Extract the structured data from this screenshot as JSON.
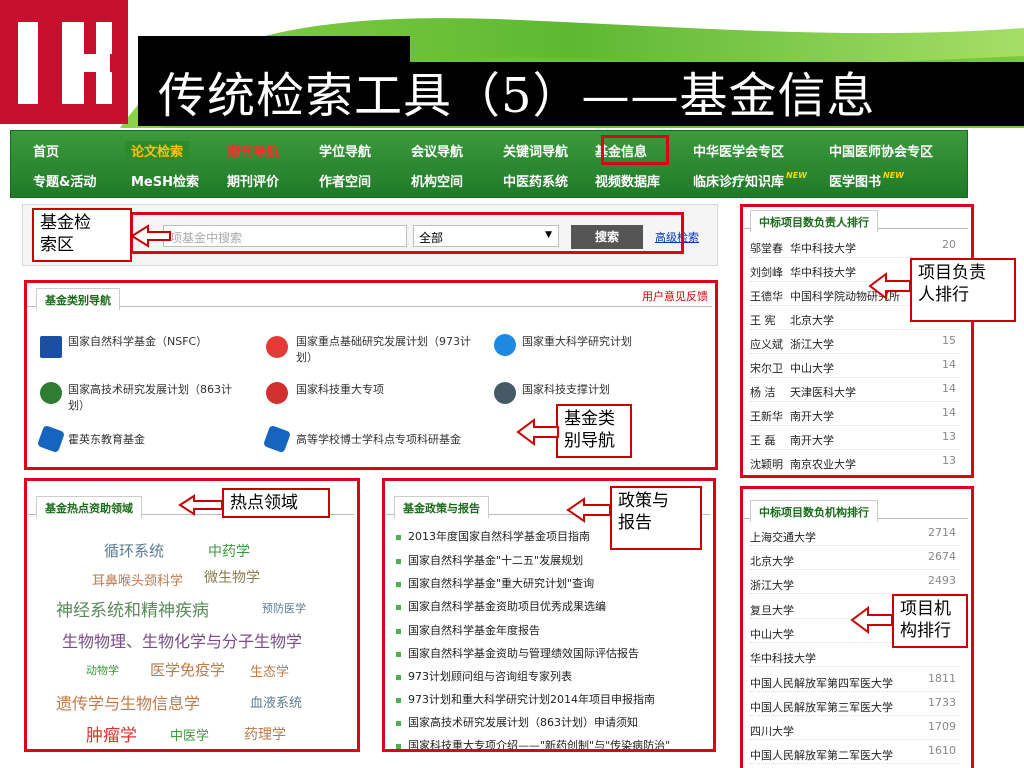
{
  "slide": {
    "title": "传统检索工具（5）——基金信息"
  },
  "colors": {
    "brand_green": "#2d8a2d",
    "annotation_red": "#e0001b",
    "logo_red": "#c8102e"
  },
  "nav": {
    "row1": [
      "首页",
      "论文检索",
      "期刊导航",
      "学位导航",
      "会议导航",
      "关键词导航",
      "基金信息",
      "中华医学会专区",
      "中国医师协会专区"
    ],
    "row2": [
      "专题&活动",
      "MeSH检索",
      "期刊评价",
      "作者空间",
      "机构空间",
      "中医药系统",
      "视频数据库",
      "临床诊疗知识库",
      "医学图书"
    ],
    "new_badge": "NEW"
  },
  "search": {
    "callout": "基金检索区",
    "placeholder": "项基金中搜索",
    "scope": "全部",
    "button": "搜索",
    "advanced": "高级检索"
  },
  "category_nav": {
    "tab": "基金类别导航",
    "feedback": "用户意见反馈",
    "callout": "基金类别导航",
    "items": [
      "国家自然科学基金（NSFC）",
      "国家重点基础研究发展计划（973计划）",
      "国家重大科学研究计划",
      "国家高技术研究发展计划（863计划）",
      "国家科技重大专项",
      "国家科技支撑计划",
      "霍英东教育基金",
      "高等学校博士学科点专项科研基金"
    ]
  },
  "leader_rank": {
    "tab": "中标项目数负责人排行",
    "callout": "项目负责人排行",
    "rows": [
      {
        "name": "邬堂春",
        "org": "华中科技大学",
        "count": "20"
      },
      {
        "name": "刘剑峰",
        "org": "华中科技大学",
        "count": "16"
      },
      {
        "name": "王德华",
        "org": "中国科学院动物研究所",
        "count": ""
      },
      {
        "name": "王  宪",
        "org": "北京大学",
        "count": ""
      },
      {
        "name": "应义斌",
        "org": "浙江大学",
        "count": "15"
      },
      {
        "name": "宋尔卫",
        "org": "中山大学",
        "count": "14"
      },
      {
        "name": "杨  洁",
        "org": "天津医科大学",
        "count": "14"
      },
      {
        "name": "王新华",
        "org": "南开大学",
        "count": "14"
      },
      {
        "name": "王  磊",
        "org": "南开大学",
        "count": "13"
      },
      {
        "name": "沈颖明",
        "org": "南京农业大学",
        "count": "13"
      }
    ]
  },
  "hot_topics": {
    "tab": "基金热点资助领域",
    "callout": "热点领域",
    "keywords": [
      "循环系统",
      "中药学",
      "耳鼻喉头颈科学",
      "微生物学",
      "神经系统和精神疾病",
      "预防医学",
      "生物物理、生物化学与分子生物学",
      "动物学",
      "医学免疫学",
      "生态学",
      "遗传学与生物信息学",
      "血液系统",
      "肿瘤学",
      "中医学",
      "药理学"
    ]
  },
  "policy": {
    "tab": "基金政策与报告",
    "callout": "政策与报告",
    "items": [
      "2013年度国家自然科学基金项目指南",
      "国家自然科学基金\"十二五\"发展规划",
      "国家自然科学基金\"重大研究计划\"查询",
      "国家自然科学基金资助项目优秀成果选编",
      "国家自然科学基金年度报告",
      "国家自然科学基金资助与管理绩效国际评估报告",
      "973计划顾问组与咨询组专家列表",
      "973计划和重大科学研究计划2014年项目申报指南",
      "国家高技术研究发展计划（863计划）申请须知",
      "国家科技重大专项介绍——\"新药创制\"与\"传染病防治\""
    ]
  },
  "institution_rank": {
    "tab": "中标项目数负机构排行",
    "callout": "项目机构排行",
    "rows": [
      {
        "org": "上海交通大学",
        "count": "2714"
      },
      {
        "org": "北京大学",
        "count": "2674"
      },
      {
        "org": "浙江大学",
        "count": "2493"
      },
      {
        "org": "复旦大学",
        "count": ""
      },
      {
        "org": "中山大学",
        "count": ""
      },
      {
        "org": "华中科技大学",
        "count": ""
      },
      {
        "org": "中国人民解放军第四军医大学",
        "count": "1811"
      },
      {
        "org": "中国人民解放军第三军医大学",
        "count": "1733"
      },
      {
        "org": "四川大学",
        "count": "1709"
      },
      {
        "org": "中国人民解放军第二军医大学",
        "count": "1610"
      }
    ]
  }
}
